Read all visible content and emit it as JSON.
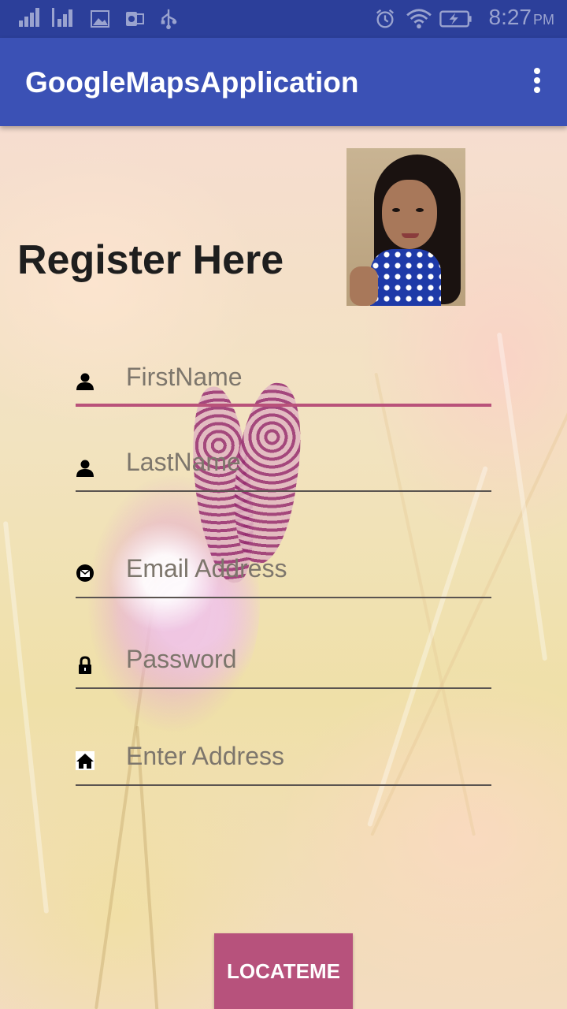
{
  "status_bar": {
    "time": "8:27",
    "ampm": "PM",
    "icons": [
      "signal-icon",
      "signal-roaming-icon",
      "image-icon",
      "outlook-icon",
      "usb-icon",
      "alarm-icon",
      "wifi-icon",
      "battery-charging-icon"
    ]
  },
  "app_bar": {
    "title": "GoogleMapsApplication",
    "menu_icon": "overflow-menu-icon"
  },
  "page": {
    "title": "Register Here",
    "avatar_icon": "profile-photo"
  },
  "form": {
    "first_name": {
      "placeholder": "FirstName",
      "value": "",
      "icon": "person-icon"
    },
    "last_name": {
      "placeholder": "LastName",
      "value": "",
      "icon": "person-icon"
    },
    "email": {
      "placeholder": "Email Address",
      "value": "",
      "icon": "email-icon"
    },
    "password": {
      "placeholder": "Password",
      "value": "",
      "icon": "lock-icon"
    },
    "address": {
      "placeholder": "Enter Address",
      "value": "",
      "icon": "home-icon"
    }
  },
  "buttons": {
    "locate_label": "LOCATEME"
  },
  "colors": {
    "status_bar": "#2c3f9a",
    "app_bar": "#3b51b5",
    "accent": "#b9527a",
    "button": "#b7527c"
  }
}
